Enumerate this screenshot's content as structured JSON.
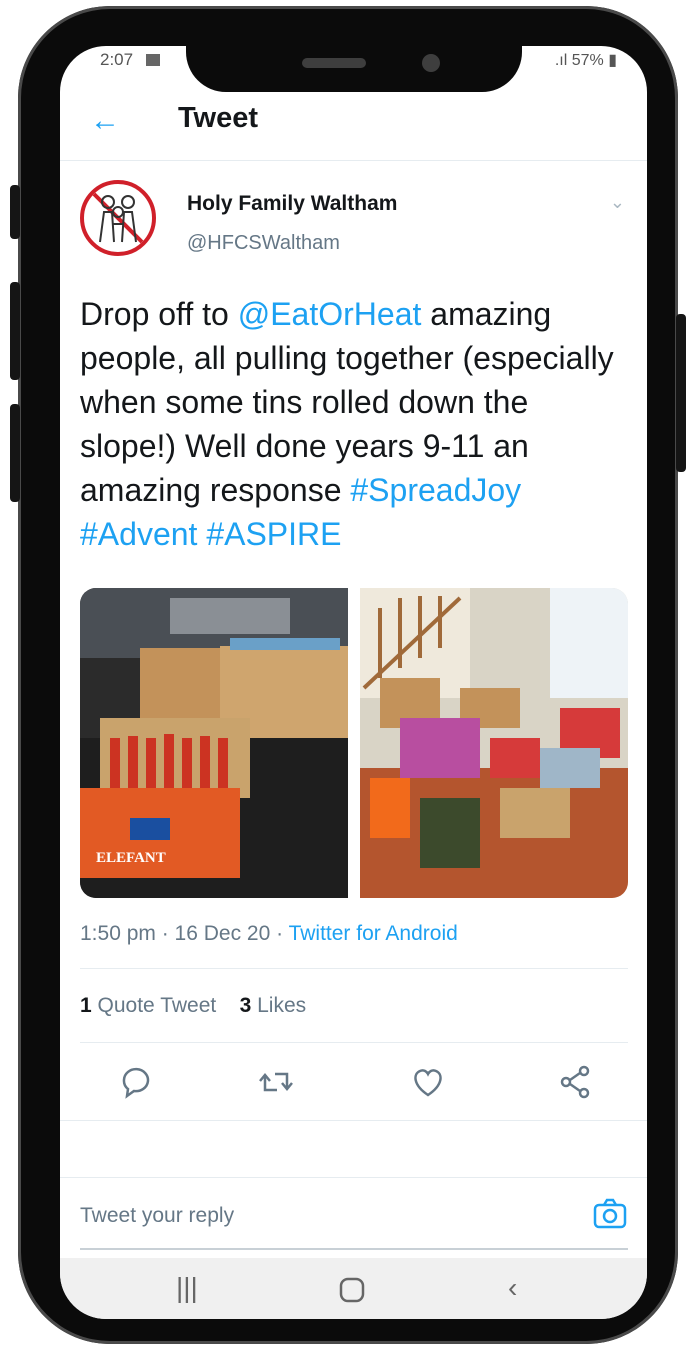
{
  "status": {
    "time": "2:07",
    "battery": "57%"
  },
  "header": {
    "title": "Tweet"
  },
  "tweet": {
    "author_name": "Holy Family Waltham",
    "author_handle": "@HFCSWaltham",
    "text_parts": [
      "Drop off to ",
      "@EatOrHeat",
      " amazing people, all pulling together (especially when some tins rolled down the slope!) Well done years 9-11 an amazing response ",
      "#SpreadJoy #Advent #ASPIRE"
    ],
    "photos": [
      {
        "description_icon": "car-boot-photo",
        "box_label": "ELEFANT"
      },
      {
        "description_icon": "hallway-donations-photo"
      }
    ],
    "timestamp": "1:50 pm · 16 Dec 20 · ",
    "source": "Twitter for Android",
    "quote_count": "1",
    "quote_label": "Quote Tweet",
    "like_count": "3",
    "like_label": "Likes"
  },
  "reply": {
    "placeholder": "Tweet your reply"
  },
  "colors": {
    "accent": "#1da1f2",
    "text": "#14171a",
    "muted": "#657786",
    "avatar_border": "#d0202a"
  },
  "icons": [
    "back-arrow-icon",
    "chevron-down-icon",
    "reply-icon",
    "retweet-icon",
    "like-icon",
    "share-icon",
    "camera-icon",
    "recents-icon",
    "home-icon",
    "back-icon"
  ]
}
